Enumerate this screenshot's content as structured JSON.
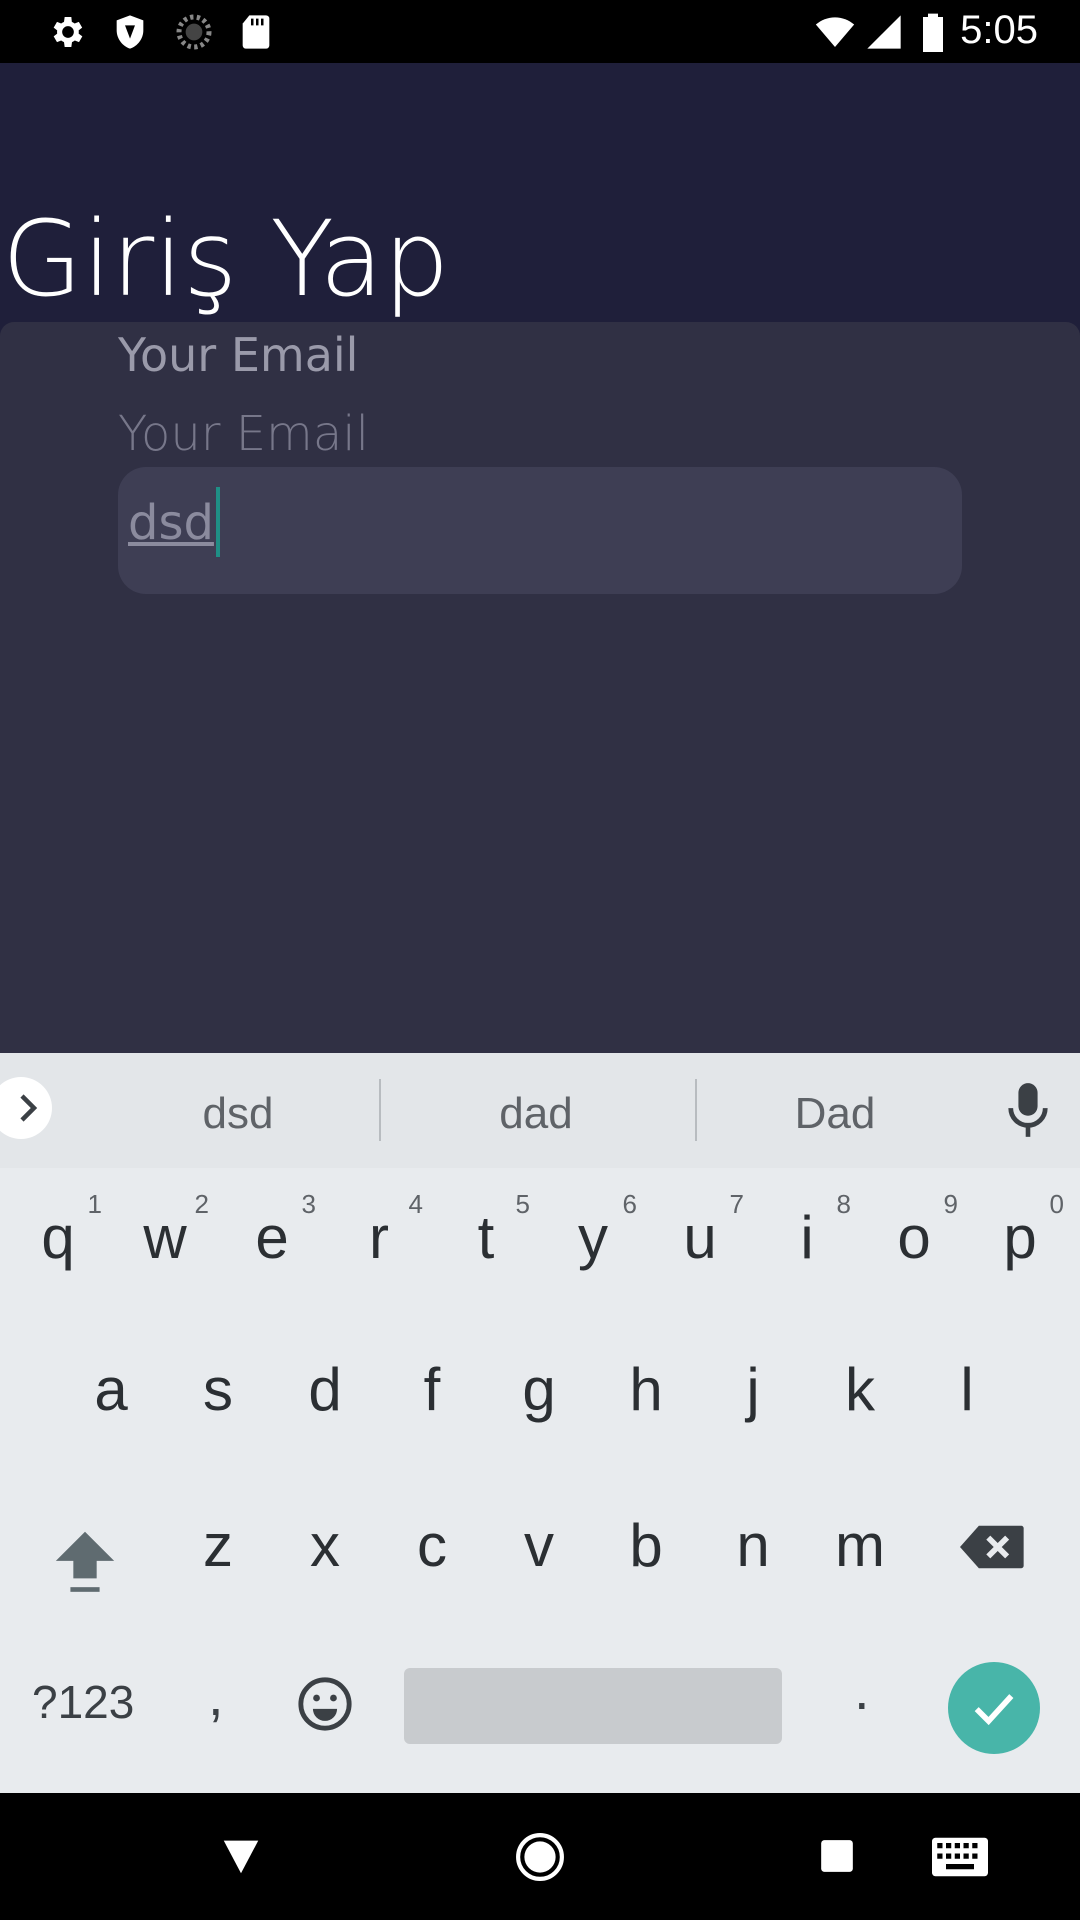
{
  "status_bar": {
    "time": "5:05",
    "left_icons": [
      "settings-icon",
      "shield-icon",
      "sync-icon",
      "sd-card-icon"
    ],
    "right_icons": [
      "wifi-icon",
      "cell-signal-icon",
      "battery-icon"
    ]
  },
  "screen": {
    "title": "Giriş Yap",
    "email_label": "Your Email",
    "email_hint": "Your Email",
    "email_value": "dsd"
  },
  "keyboard": {
    "suggestions": [
      "dsd",
      "dad",
      "Dad"
    ],
    "row1": [
      {
        "key": "q",
        "num": "1"
      },
      {
        "key": "w",
        "num": "2"
      },
      {
        "key": "e",
        "num": "3"
      },
      {
        "key": "r",
        "num": "4"
      },
      {
        "key": "t",
        "num": "5"
      },
      {
        "key": "y",
        "num": "6"
      },
      {
        "key": "u",
        "num": "7"
      },
      {
        "key": "i",
        "num": "8"
      },
      {
        "key": "o",
        "num": "9"
      },
      {
        "key": "p",
        "num": "0"
      }
    ],
    "row2": [
      "a",
      "s",
      "d",
      "f",
      "g",
      "h",
      "j",
      "k",
      "l"
    ],
    "row3": [
      "z",
      "x",
      "c",
      "v",
      "b",
      "n",
      "m"
    ],
    "symbols_label": "?123",
    "comma_label": ",",
    "period_label": ".",
    "accent_color": "#48b5a9"
  },
  "nav_bar": {
    "icons": [
      "back-icon",
      "home-icon",
      "recents-icon",
      "keyboard-switch-icon"
    ]
  }
}
